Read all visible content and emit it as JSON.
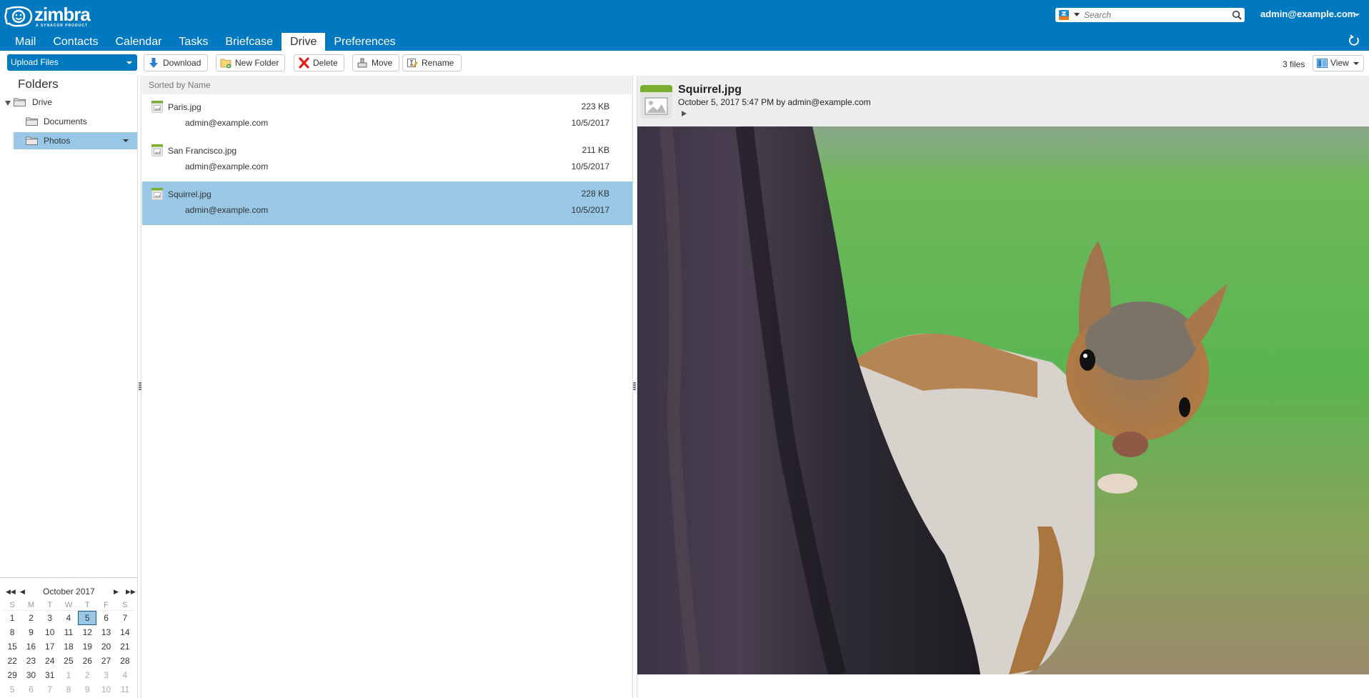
{
  "app": {
    "logo_text": "zimbra",
    "logo_tagline": "A SYNACOR PRODUCT",
    "search_placeholder": "Search",
    "user": "admin@example.com"
  },
  "nav": {
    "tabs": [
      {
        "label": "Mail",
        "active": false
      },
      {
        "label": "Contacts",
        "active": false
      },
      {
        "label": "Calendar",
        "active": false
      },
      {
        "label": "Tasks",
        "active": false
      },
      {
        "label": "Briefcase",
        "active": false
      },
      {
        "label": "Drive",
        "active": true
      },
      {
        "label": "Preferences",
        "active": false
      }
    ]
  },
  "toolbar": {
    "upload_label": "Upload Files",
    "download_label": "Download",
    "new_folder_label": "New Folder",
    "delete_label": "Delete",
    "move_label": "Move",
    "rename_label": "Rename",
    "file_count": "3 files",
    "view_label": "View"
  },
  "sidebar": {
    "title": "Folders",
    "tree": [
      {
        "label": "Drive",
        "level": 0,
        "expanded": true,
        "selected": false
      },
      {
        "label": "Documents",
        "level": 1,
        "selected": false
      },
      {
        "label": "Photos",
        "level": 1,
        "selected": true
      }
    ]
  },
  "calendar": {
    "month_label": "October 2017",
    "days_of_week": [
      "S",
      "M",
      "T",
      "W",
      "T",
      "F",
      "S"
    ],
    "selected_day": 5,
    "weeks": [
      [
        {
          "d": "1"
        },
        {
          "d": "2"
        },
        {
          "d": "3"
        },
        {
          "d": "4"
        },
        {
          "d": "5",
          "sel": true
        },
        {
          "d": "6"
        },
        {
          "d": "7"
        }
      ],
      [
        {
          "d": "8"
        },
        {
          "d": "9"
        },
        {
          "d": "10"
        },
        {
          "d": "11"
        },
        {
          "d": "12"
        },
        {
          "d": "13"
        },
        {
          "d": "14"
        }
      ],
      [
        {
          "d": "15"
        },
        {
          "d": "16"
        },
        {
          "d": "17"
        },
        {
          "d": "18"
        },
        {
          "d": "19"
        },
        {
          "d": "20"
        },
        {
          "d": "21"
        }
      ],
      [
        {
          "d": "22"
        },
        {
          "d": "23"
        },
        {
          "d": "24"
        },
        {
          "d": "25"
        },
        {
          "d": "26"
        },
        {
          "d": "27"
        },
        {
          "d": "28"
        }
      ],
      [
        {
          "d": "29"
        },
        {
          "d": "30"
        },
        {
          "d": "31"
        },
        {
          "d": "1",
          "other": true
        },
        {
          "d": "2",
          "other": true
        },
        {
          "d": "3",
          "other": true
        },
        {
          "d": "4",
          "other": true
        }
      ],
      [
        {
          "d": "5",
          "other": true
        },
        {
          "d": "6",
          "other": true
        },
        {
          "d": "7",
          "other": true
        },
        {
          "d": "8",
          "other": true
        },
        {
          "d": "9",
          "other": true
        },
        {
          "d": "10",
          "other": true
        },
        {
          "d": "11",
          "other": true
        }
      ]
    ]
  },
  "list": {
    "sort_label": "Sorted by Name",
    "files": [
      {
        "name": "Paris.jpg",
        "size": "223 KB",
        "owner": "admin@example.com",
        "date": "10/5/2017",
        "selected": false
      },
      {
        "name": "San Francisco.jpg",
        "size": "211 KB",
        "owner": "admin@example.com",
        "date": "10/5/2017",
        "selected": false
      },
      {
        "name": "Squirrel.jpg",
        "size": "228 KB",
        "owner": "admin@example.com",
        "date": "10/5/2017",
        "selected": true
      }
    ]
  },
  "preview": {
    "title": "Squirrel.jpg",
    "meta": "October 5, 2017 5:47 PM by admin@example.com",
    "image_description": "Gray squirrel peeking around a tree trunk against a green blurred background"
  },
  "colors": {
    "brand": "#0079c1",
    "selection": "#98c8e6",
    "file_icon_accent": "#7aae2e"
  }
}
